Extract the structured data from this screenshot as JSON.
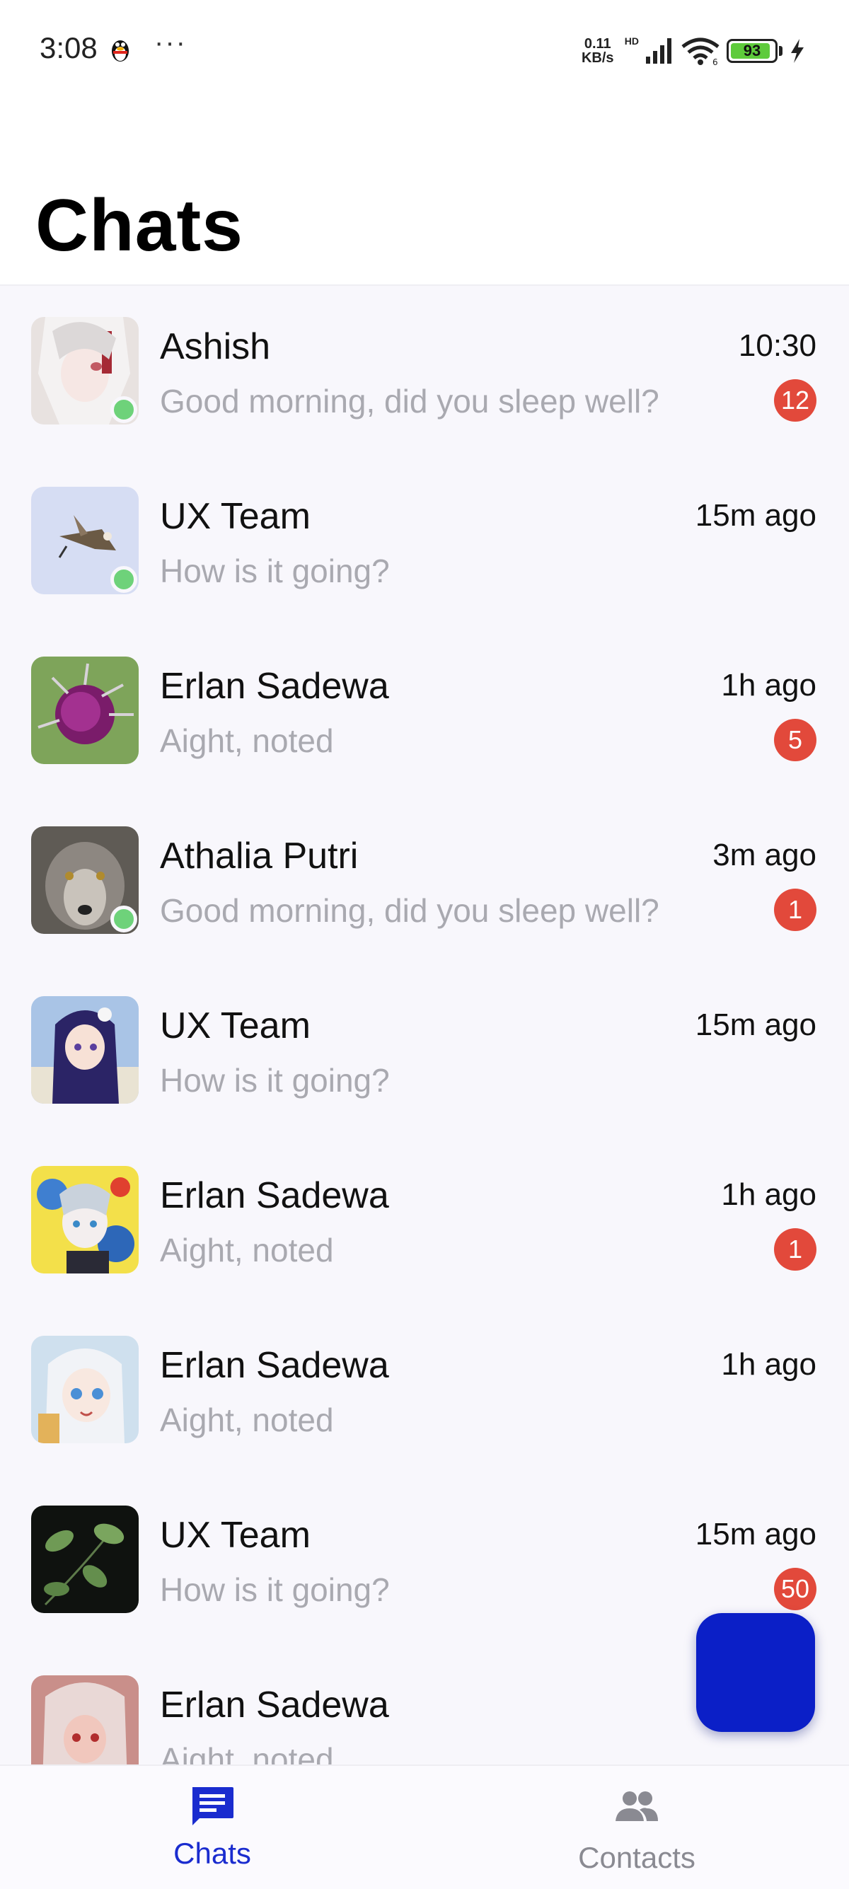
{
  "status_bar": {
    "time": "3:08",
    "more": "···",
    "net_speed_value": "0.11",
    "net_speed_unit": "KB/s",
    "hd": "HD",
    "battery_level": "93",
    "battery_fraction": 0.93
  },
  "header": {
    "title": "Chats"
  },
  "chats": [
    {
      "name": "Ashish",
      "time": "10:30",
      "message": "Good morning, did you sleep well?",
      "badge": "12",
      "online": true
    },
    {
      "name": "UX Team",
      "time": "15m ago",
      "message": "How is it going?",
      "badge": "",
      "online": true
    },
    {
      "name": "Erlan Sadewa",
      "time": "1h ago",
      "message": "Aight, noted",
      "badge": "5",
      "online": false
    },
    {
      "name": "Athalia Putri",
      "time": "3m ago",
      "message": "Good morning, did you sleep well?",
      "badge": "1",
      "online": true
    },
    {
      "name": "UX Team",
      "time": "15m ago",
      "message": "How is it going?",
      "badge": "",
      "online": false
    },
    {
      "name": "Erlan Sadewa",
      "time": "1h ago",
      "message": "Aight, noted",
      "badge": "1",
      "online": false
    },
    {
      "name": "Erlan Sadewa",
      "time": "1h ago",
      "message": "Aight, noted",
      "badge": "",
      "online": false
    },
    {
      "name": "UX Team",
      "time": "15m ago",
      "message": "How is it going?",
      "badge": "50",
      "online": false
    },
    {
      "name": "Erlan Sadewa",
      "time": "",
      "message": "Aight, noted",
      "badge": "",
      "online": false
    }
  ],
  "bottom_nav": {
    "chats_label": "Chats",
    "contacts_label": "Contacts"
  },
  "colors": {
    "accent": "#1a2ccf",
    "fab": "#0b1fc7",
    "badge": "#e2493b",
    "online": "#6ed27a"
  }
}
